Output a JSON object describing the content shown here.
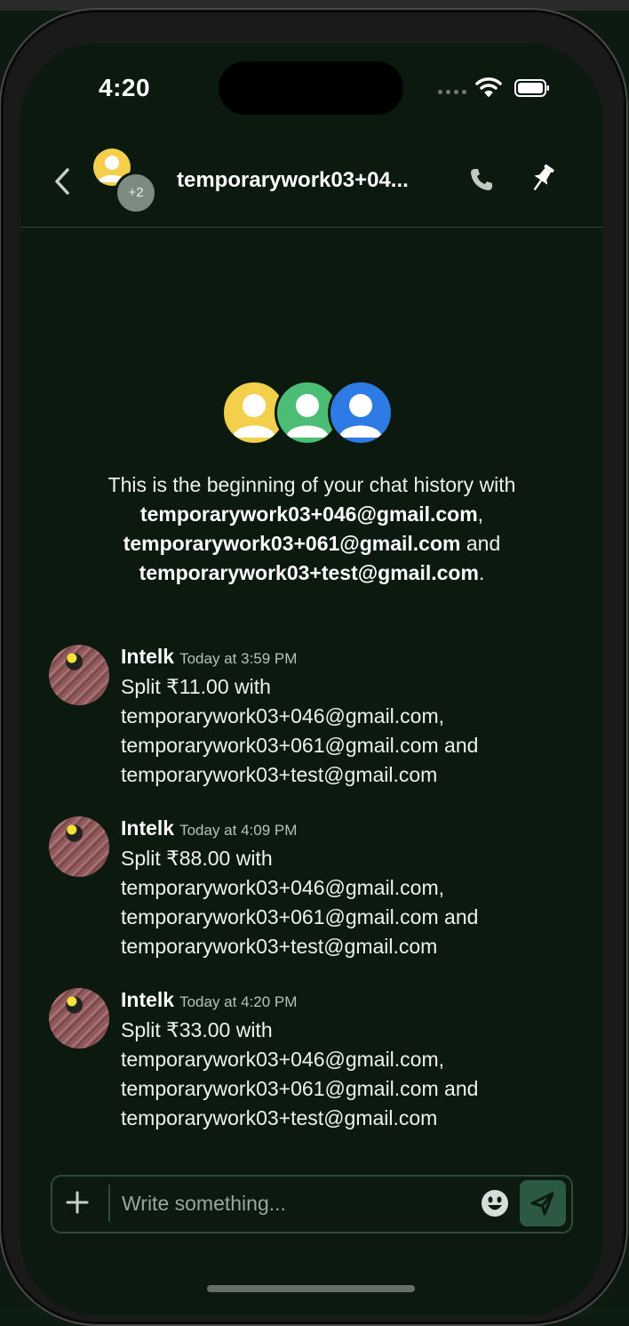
{
  "status": {
    "time": "4:20"
  },
  "header": {
    "title": "temporarywork03+04...",
    "member_badge": "+2"
  },
  "intro": {
    "text_prefix": "This is the beginning of your chat history with ",
    "user1": "temporarywork03+046@gmail.com",
    "sep1": ", ",
    "user2": "temporarywork03+061@gmail.com",
    "sep2": " and ",
    "user3": "temporarywork03+test@gmail.com",
    "suffix": "."
  },
  "messages": [
    {
      "author": "Intelk",
      "time": "Today at 3:59 PM",
      "line1": "Split ₹11.00 with",
      "line2": "temporarywork03+046@gmail.com,",
      "line3": "temporarywork03+061@gmail.com and",
      "line4": "temporarywork03+test@gmail.com"
    },
    {
      "author": "Intelk",
      "time": "Today at 4:09 PM",
      "line1": "Split ₹88.00 with",
      "line2": "temporarywork03+046@gmail.com,",
      "line3": "temporarywork03+061@gmail.com and",
      "line4": "temporarywork03+test@gmail.com"
    },
    {
      "author": "Intelk",
      "time": "Today at 4:20 PM",
      "line1": "Split ₹33.00 with",
      "line2": "temporarywork03+046@gmail.com,",
      "line3": "temporarywork03+061@gmail.com and",
      "line4": "temporarywork03+test@gmail.com"
    }
  ],
  "composer": {
    "placeholder": "Write something..."
  },
  "colors": {
    "background": "#0b190e",
    "accent": "#2b5a40",
    "avatar_yellow": "#f3cf4c",
    "avatar_green": "#4cbd75",
    "avatar_blue": "#2f7be6"
  },
  "icons": [
    "back-chevron-icon",
    "phone-icon",
    "pin-icon",
    "plus-icon",
    "emoji-icon",
    "send-icon",
    "wifi-icon",
    "battery-icon"
  ]
}
